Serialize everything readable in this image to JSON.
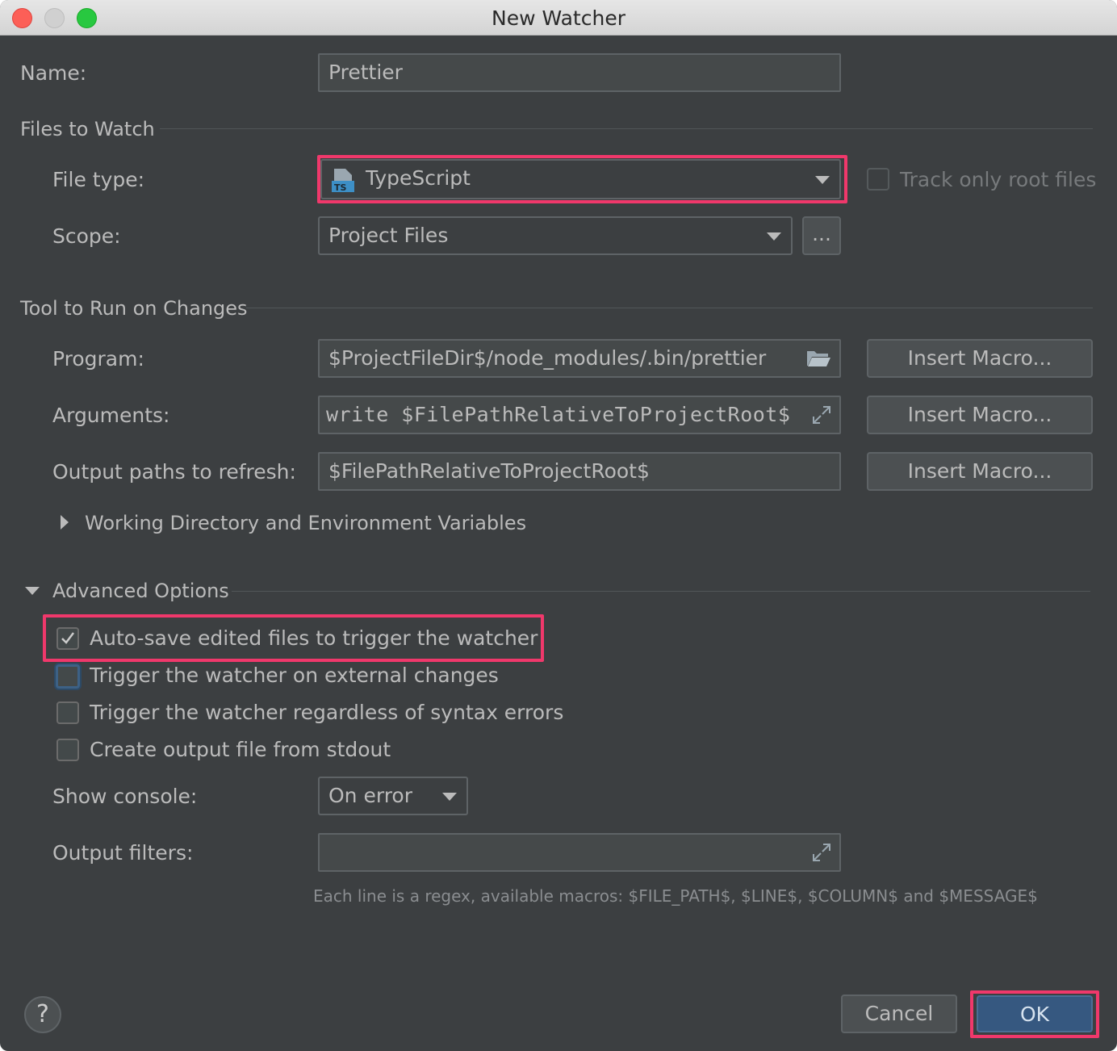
{
  "window": {
    "title": "New Watcher"
  },
  "name": {
    "label": "Name:",
    "value": "Prettier"
  },
  "files_to_watch": {
    "section": "Files to Watch",
    "file_type_label": "File type:",
    "file_type_value": "TypeScript",
    "file_type_icon": "typescript-file-icon",
    "track_root_label": "Track only root files",
    "track_root_checked": false,
    "scope_label": "Scope:",
    "scope_value": "Project Files",
    "scope_more": "..."
  },
  "tool": {
    "section": "Tool to Run on Changes",
    "program_label": "Program:",
    "program_value": "$ProjectFileDir$/node_modules/.bin/prettier",
    "arguments_label": "Arguments:",
    "arguments_value": "write $FilePathRelativeToProjectRoot$",
    "output_label": "Output paths to refresh:",
    "output_value": "$FilePathRelativeToProjectRoot$",
    "insert_macro": "Insert Macro...",
    "working_dir": "Working Directory and Environment Variables"
  },
  "advanced": {
    "section": "Advanced Options",
    "options": [
      {
        "label": "Auto-save edited files to trigger the watcher",
        "checked": true
      },
      {
        "label": "Trigger the watcher on external changes",
        "checked": false
      },
      {
        "label": "Trigger the watcher regardless of syntax errors",
        "checked": false
      },
      {
        "label": "Create output file from stdout",
        "checked": false
      }
    ],
    "show_console_label": "Show console:",
    "show_console_value": "On error",
    "output_filters_label": "Output filters:",
    "output_filters_value": "",
    "hint": "Each line is a regex, available macros: $FILE_PATH$, $LINE$, $COLUMN$ and $MESSAGE$"
  },
  "footer": {
    "help": "?",
    "cancel": "Cancel",
    "ok": "OK"
  },
  "colors": {
    "background": "#3c3f41",
    "highlight": "#f0386b",
    "ok_button": "#365880",
    "focus": "#3d6185"
  }
}
